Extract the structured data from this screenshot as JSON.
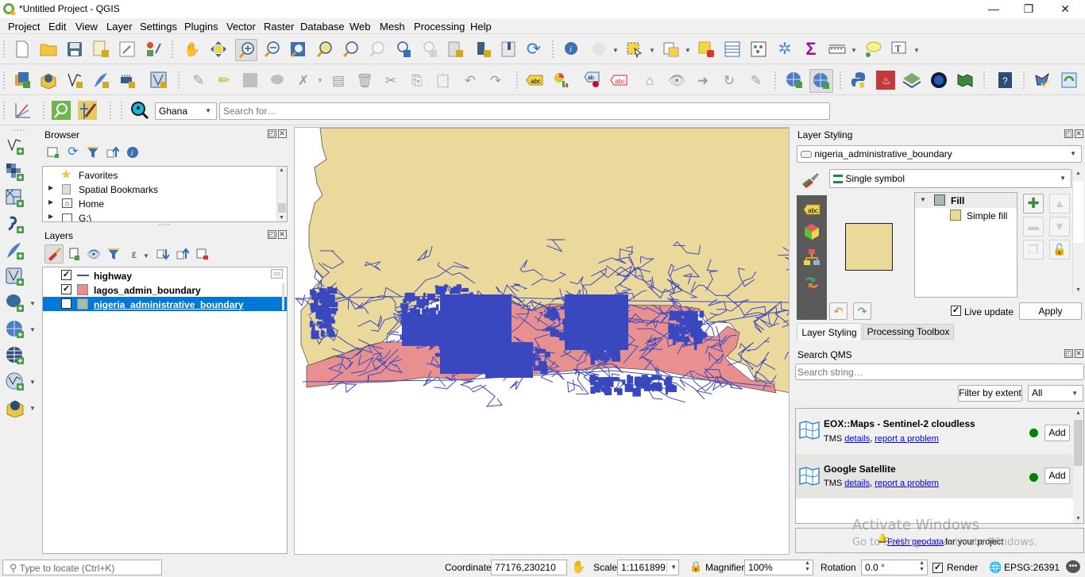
{
  "window": {
    "title": "*Untitled Project - QGIS",
    "controls": {
      "minimize": "—",
      "restore": "❐",
      "close": "✕"
    }
  },
  "menu": [
    "Project",
    "Edit",
    "View",
    "Layer",
    "Settings",
    "Plugins",
    "Vector",
    "Raster",
    "Database",
    "Web",
    "Mesh",
    "Processing",
    "Help"
  ],
  "toolbar": {
    "geocoder_country": "Ghana",
    "search_placeholder": "Search for…"
  },
  "browser": {
    "title": "Browser",
    "items": [
      {
        "label": "Favorites",
        "icon": "star-icon"
      },
      {
        "label": "Spatial Bookmarks",
        "icon": "bookmark-icon"
      },
      {
        "label": "Home",
        "icon": "home-folder-icon"
      },
      {
        "label": "G:\\",
        "icon": "folder-icon"
      }
    ]
  },
  "layers": {
    "title": "Layers",
    "items": [
      {
        "label": "highway",
        "checked": true,
        "symbol": "line",
        "color": "#3f49b6"
      },
      {
        "label": "lagos_admin_boundary",
        "checked": true,
        "symbol": "fill",
        "color": "#e8908f"
      },
      {
        "label": "nigeria_administrative_boundary",
        "checked": true,
        "symbol": "fill",
        "color": "#a3bcaf",
        "selected": true
      }
    ]
  },
  "layer_styling": {
    "title": "Layer Styling",
    "layer": "nigeria_administrative_boundary",
    "renderer": "Single symbol",
    "symbol_tree": [
      {
        "label": "Fill",
        "color": "#a3bcaf"
      },
      {
        "label": "Simple fill",
        "color": "#ead99b"
      }
    ],
    "preview_color": "#ead99b",
    "live_update_label": "Live update",
    "live_update": true,
    "apply_label": "Apply",
    "tabs": [
      "Layer Styling",
      "Processing Toolbox"
    ]
  },
  "qms": {
    "title": "Search QMS",
    "search_placeholder": "Search string…",
    "filter_button": "Filter by extent",
    "filter_value": "All",
    "results": [
      {
        "name": "EOX::Maps - Sentinel-2 cloudless",
        "type": "TMS",
        "details": "details",
        "report": "report a problem",
        "status_color": "#008000",
        "add_label": "Add"
      },
      {
        "name": "Google Satellite",
        "type": "TMS",
        "details": "details",
        "report": "report a problem",
        "status_color": "#008000",
        "add_label": "Add"
      }
    ],
    "footer_link": "Fresh geodata",
    "footer_text": "for your project"
  },
  "watermark": {
    "line1": "Activate Windows",
    "line2": "Go to Settings to activate Windows."
  },
  "status": {
    "locate_placeholder": "Type to locate (Ctrl+K)",
    "coordinate_label": "Coordinate",
    "coordinate": "77176,230210",
    "scale_label": "Scale",
    "scale": "1:1161899",
    "magnifier_label": "Magnifier",
    "magnifier": "100%",
    "rotation_label": "Rotation",
    "rotation": "0.0 °",
    "render_label": "Render",
    "render": true,
    "crs": "EPSG:26391"
  },
  "map_colors": {
    "nigeria": "#ead99b",
    "lagos": "#e8908f",
    "highway": "#3f49bf"
  }
}
